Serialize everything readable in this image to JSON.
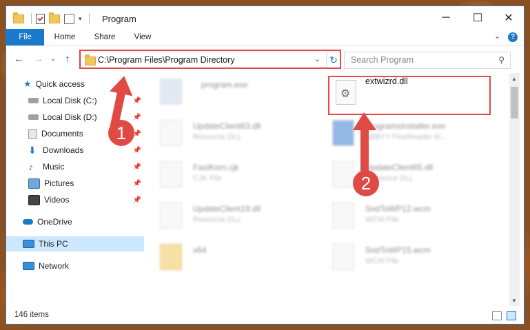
{
  "window": {
    "title": "Program",
    "min_glyph": "─",
    "max_glyph": "☐",
    "close_glyph": "✕"
  },
  "ribbon": {
    "tabs": [
      "File",
      "Home",
      "Share",
      "View"
    ],
    "expand_glyph": "⌄",
    "help_glyph": "?"
  },
  "nav": {
    "back": "←",
    "forward": "→",
    "recent": "⌄",
    "up": "↑"
  },
  "address": {
    "path": "C:\\Program Files\\Program Directory",
    "dropdown": "⌄",
    "refresh": "↻"
  },
  "search": {
    "placeholder": "Search Program",
    "icon": "⚲"
  },
  "sidebar": {
    "items": [
      {
        "label": "Quick access",
        "icon": "star-icon",
        "pinned": false
      },
      {
        "label": "Local Disk (C:)",
        "icon": "drive-icon",
        "pinned": true
      },
      {
        "label": "Local Disk (D:)",
        "icon": "drive-icon",
        "pinned": true
      },
      {
        "label": "Documents",
        "icon": "documents-icon",
        "pinned": true
      },
      {
        "label": "Downloads",
        "icon": "downloads-icon",
        "pinned": true
      },
      {
        "label": "Music",
        "icon": "music-icon",
        "pinned": true
      },
      {
        "label": "Pictures",
        "icon": "pictures-icon",
        "pinned": true
      },
      {
        "label": "Videos",
        "icon": "videos-icon",
        "pinned": true
      },
      {
        "label": "OneDrive",
        "icon": "cloud-icon",
        "pinned": false
      },
      {
        "label": "This PC",
        "icon": "pc-icon",
        "pinned": false,
        "selected": true
      },
      {
        "label": "Network",
        "icon": "network-icon",
        "pinned": false
      }
    ],
    "pin_glyph": "📌"
  },
  "files": [
    {
      "name": "program.exe",
      "type": ""
    },
    {
      "name": "extwizrd.dll",
      "type": ""
    },
    {
      "name": "UpdateClient63.dll",
      "type": "Resource DLL"
    },
    {
      "name": "ProgramsInstaller.exe",
      "type": "ABBYY FineReader tri..."
    },
    {
      "name": "FastKorn.cjk",
      "type": "CJK File"
    },
    {
      "name": "UpdateClient65.dll",
      "type": "Resource DLL"
    },
    {
      "name": "UpdateClient19.dll",
      "type": "Resource DLL"
    },
    {
      "name": "SndToWP12.wcm",
      "type": "WCM File"
    },
    {
      "name": "x64",
      "type": ""
    },
    {
      "name": "SndToWP15.wcm",
      "type": "WCM File"
    }
  ],
  "status": {
    "item_count": "146 items"
  },
  "annotations": {
    "step1": "1",
    "step2": "2"
  },
  "colors": {
    "accent": "#1979ca",
    "highlight": "#e04a44",
    "selected_bg": "#cce8ff"
  }
}
